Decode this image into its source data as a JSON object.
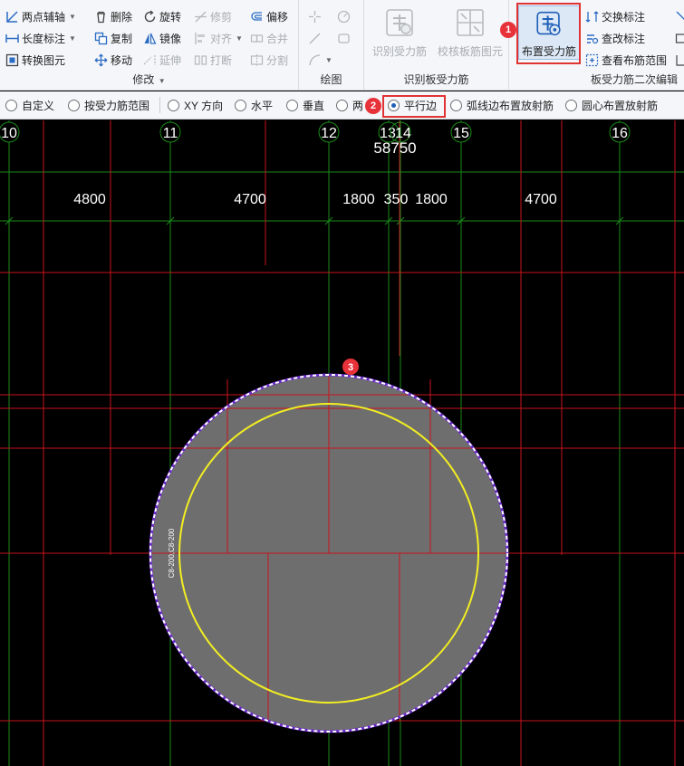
{
  "ribbon": {
    "modify": {
      "title": "修改",
      "items": {
        "two_point_axis": "两点辅轴",
        "length_dim": "长度标注",
        "convert_element": "转换图元",
        "delete": "删除",
        "copy": "复制",
        "move": "移动",
        "rotate": "旋转",
        "mirror": "镜像",
        "extend": "延伸",
        "trim": "修剪",
        "align": "对齐",
        "break": "打断",
        "offset": "偏移",
        "merge": "合并",
        "split": "分割"
      }
    },
    "draw": {
      "title": "绘图"
    },
    "identify": {
      "title": "识别板受力筋",
      "identify_rebar": "识别受力筋",
      "verify_rebar": "校核板筋图元"
    },
    "secondary_edit": {
      "title": "板受力筋二次编辑",
      "place_rebar": "布置受力筋",
      "swap_label": "交换标注",
      "check_label": "查改标注",
      "view_range": "查看布筋范围"
    }
  },
  "options": [
    {
      "label": "自定义",
      "selected": false
    },
    {
      "label": "按受力筋范围",
      "selected": false
    },
    {
      "label": "XY 方向",
      "selected": false
    },
    {
      "label": "水平",
      "selected": false
    },
    {
      "label": "垂直",
      "selected": false
    },
    {
      "label": "两",
      "selected": false
    },
    {
      "label": "平行边",
      "selected": true
    },
    {
      "label": "弧线边布置放射筋",
      "selected": false
    },
    {
      "label": "圆心布置放射筋",
      "selected": false
    }
  ],
  "markers": [
    "1",
    "2",
    "3"
  ],
  "canvas": {
    "axes": [
      "10",
      "11",
      "12",
      "13",
      "14",
      "15",
      "16"
    ],
    "total_dimension": "58750",
    "spans": [
      "4800",
      "4700",
      "1800",
      "350",
      "1800",
      "4700"
    ],
    "rebar_label": "C8-200,C8-200"
  },
  "colors": {
    "highlight": "#e03434",
    "marker": "#e8323a",
    "grid_green": "#1a8a1a",
    "beam_red": "#c8141e",
    "slab_fill": "#6e6e6e",
    "rebar_yellow": "#f2ee22",
    "selection_dash": "#ffffff"
  }
}
